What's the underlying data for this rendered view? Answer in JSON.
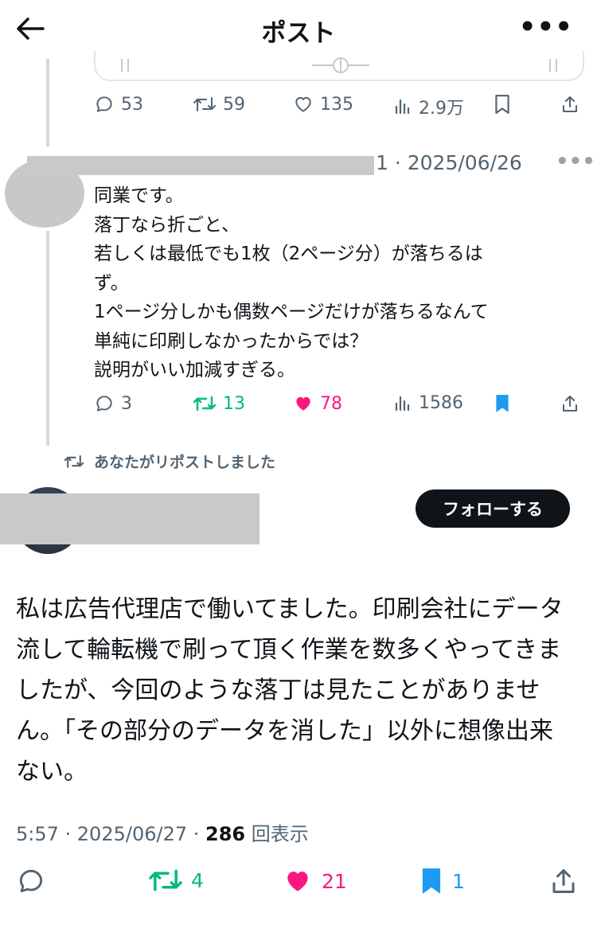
{
  "header": {
    "title": "ポスト",
    "more": "•••"
  },
  "parent_post": {
    "stats": {
      "replies": "53",
      "reposts": "59",
      "likes": "135",
      "views": "2.9万"
    }
  },
  "reply": {
    "date": "1 · 2025/06/26",
    "more": "•••",
    "text": "同業です。\n落丁なら折ごと、\n若しくは最低でも1枚（2ページ分）が落ちるは\nず。\n1ページ分しかも偶数ページだけが落ちるなんて\n単純に印刷しなかったからでは？\n説明がいい加減すぎる。",
    "stats": {
      "replies": "3",
      "reposts": "13",
      "likes": "78",
      "views": "1586"
    },
    "colors": {
      "repost": "#00ba7c",
      "like": "#f91880",
      "bookmark": "#1d9bf0"
    }
  },
  "repost_note": "あなたがリポストしました",
  "main_post": {
    "follow_label": "フォローする",
    "text": "私は広告代理店で働いてました。印刷会社にデータ\n流して輪転機で刷って頂く作業を数多くやってきま\nしたが、今回のような落丁は見たことがありませ\nん。「その部分のデータを消した」以外に想像出来\nない。",
    "time": "5:57 · 2025/06/27 · ",
    "views_count": "286",
    "views_label": " 回表示",
    "stats": {
      "reposts": "4",
      "likes": "21",
      "bookmarks": "1"
    }
  }
}
